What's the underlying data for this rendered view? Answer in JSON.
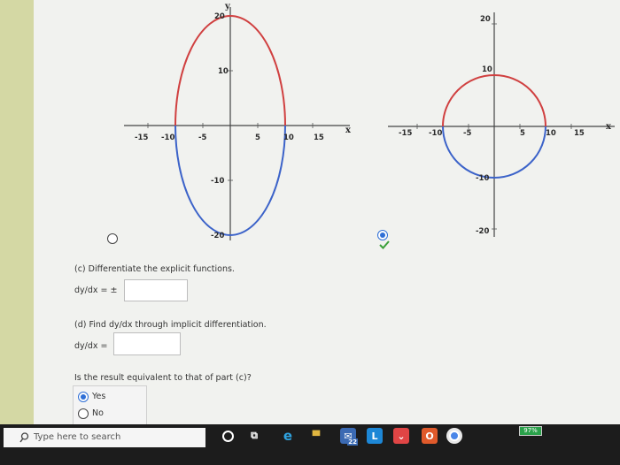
{
  "graph_left": {
    "y_axis_label": "y",
    "x_axis_label": "x",
    "x_tick_labels": [
      "-15",
      "-10",
      "-5",
      "5",
      "10",
      "15"
    ],
    "y_tick_labels": [
      "20",
      "10",
      "-10",
      "-20"
    ],
    "upper_curve_color": "#d04040",
    "lower_curve_color": "#3c63c9"
  },
  "graph_right": {
    "x_axis_label": "x",
    "x_tick_labels": [
      "-15",
      "-10",
      "-5",
      "5",
      "10",
      "15"
    ],
    "y_tick_labels": [
      "20",
      "10",
      "-10",
      "-20"
    ],
    "upper_curve_color": "#d04040",
    "lower_curve_color": "#3c63c9"
  },
  "questions": {
    "part_c_label": "(c) Differentiate the explicit functions.",
    "part_c_input_label": "dy/dx = ±",
    "part_d_label": "(d) Find dy/dx through implicit differentiation.",
    "part_d_input_label": "dy/dx =",
    "equivalence_question": "Is the result equivalent to that of part (c)?",
    "choices": [
      {
        "label": "Yes",
        "selected": true
      },
      {
        "label": "No",
        "selected": false
      }
    ]
  },
  "taskbar": {
    "search_placeholder": "Type here to search",
    "mail_badge": "22",
    "battery": "97%",
    "icons": [
      "search-icon",
      "cortana-icon",
      "task-view-icon",
      "edge-icon",
      "store-icon",
      "mail-icon",
      "launcher-icon",
      "pocket-icon",
      "office-icon",
      "chrome-icon"
    ]
  }
}
